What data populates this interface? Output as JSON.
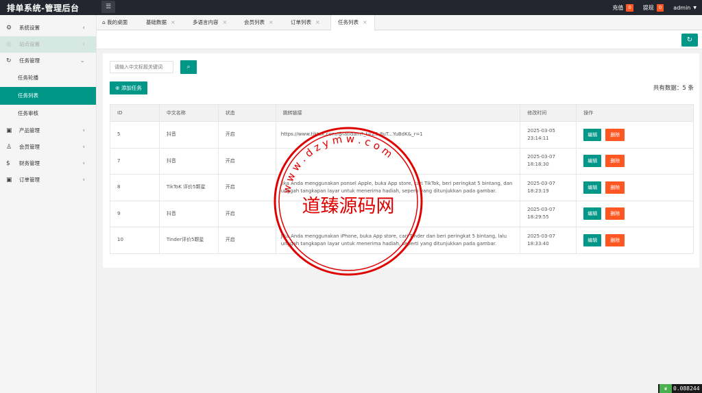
{
  "header": {
    "brand": "排单系统-管理后台",
    "menu_icon": "list-icon",
    "recharge": "充值",
    "recharge_count": "0",
    "withdraw": "提现",
    "withdraw_count": "0",
    "user": "admin"
  },
  "sidebar": {
    "items": [
      {
        "label": "系统设置",
        "icon": "gear-icon"
      },
      {
        "label": "站点设置",
        "icon": "globe-icon"
      },
      {
        "label": "任务管理",
        "icon": "refresh-icon"
      }
    ],
    "sub_items": [
      "任务轮播",
      "任务列表",
      "任务审核"
    ],
    "items2": [
      {
        "label": "产品管理",
        "icon": "cube-icon"
      },
      {
        "label": "会员管理",
        "icon": "user-icon"
      },
      {
        "label": "财务管理",
        "icon": "dollar-icon"
      },
      {
        "label": "订单管理",
        "icon": "cube-icon"
      }
    ]
  },
  "tabs": [
    "我的桌面",
    "基础数据",
    "多语言内容",
    "会员列表",
    "订单列表",
    "任务列表"
  ],
  "search": {
    "placeholder": "请输入中文标题关键词"
  },
  "add_label": "添加任务",
  "total": "共有数据：5 条",
  "table": {
    "headers": [
      "ID",
      "中文名称",
      "状态",
      "跳转链接",
      "修改时间",
      "操作"
    ],
    "rows": [
      {
        "id": "5",
        "name": "抖音",
        "status": "开启",
        "link": "https://www.tiktok.com/@latidam?_t=ZS-8uT...YuBdK&_r=1",
        "time": "2025-03-05 23:14:11"
      },
      {
        "id": "7",
        "name": "抖音",
        "status": "开启",
        "link": "",
        "time": "2025-03-07 18:18:30"
      },
      {
        "id": "8",
        "name": "TikToK 评价5颗星",
        "status": "开启",
        "link": "Jika Anda menggunakan ponsel Apple, buka App store, cari TikTok, beri peringkat 5 bintang, dan unggah tangkapan layar untuk menerima hadiah, seperti yang ditunjukkan pada gambar.",
        "time": "2025-03-07 18:23:19"
      },
      {
        "id": "9",
        "name": "抖音",
        "status": "开启",
        "link": "",
        "time": "2025-03-07 18:29:55"
      },
      {
        "id": "10",
        "name": "Tinder评价5颗星",
        "status": "开启",
        "link": "Jika Anda menggunakan iPhone, buka App store, cari Tinder dan beri peringkat 5 bintang, lalu unggah tangkapan layar untuk menerima hadiah, seperti yang ditunjukkan pada gambar.",
        "time": "2025-03-07 18:33:40"
      }
    ],
    "edit_label": "编辑",
    "delete_label": "删除"
  },
  "watermark": {
    "title": "道臻源码网",
    "ring_text": "w w w . d z y m w . c o m"
  },
  "corner_value": "0.088244"
}
